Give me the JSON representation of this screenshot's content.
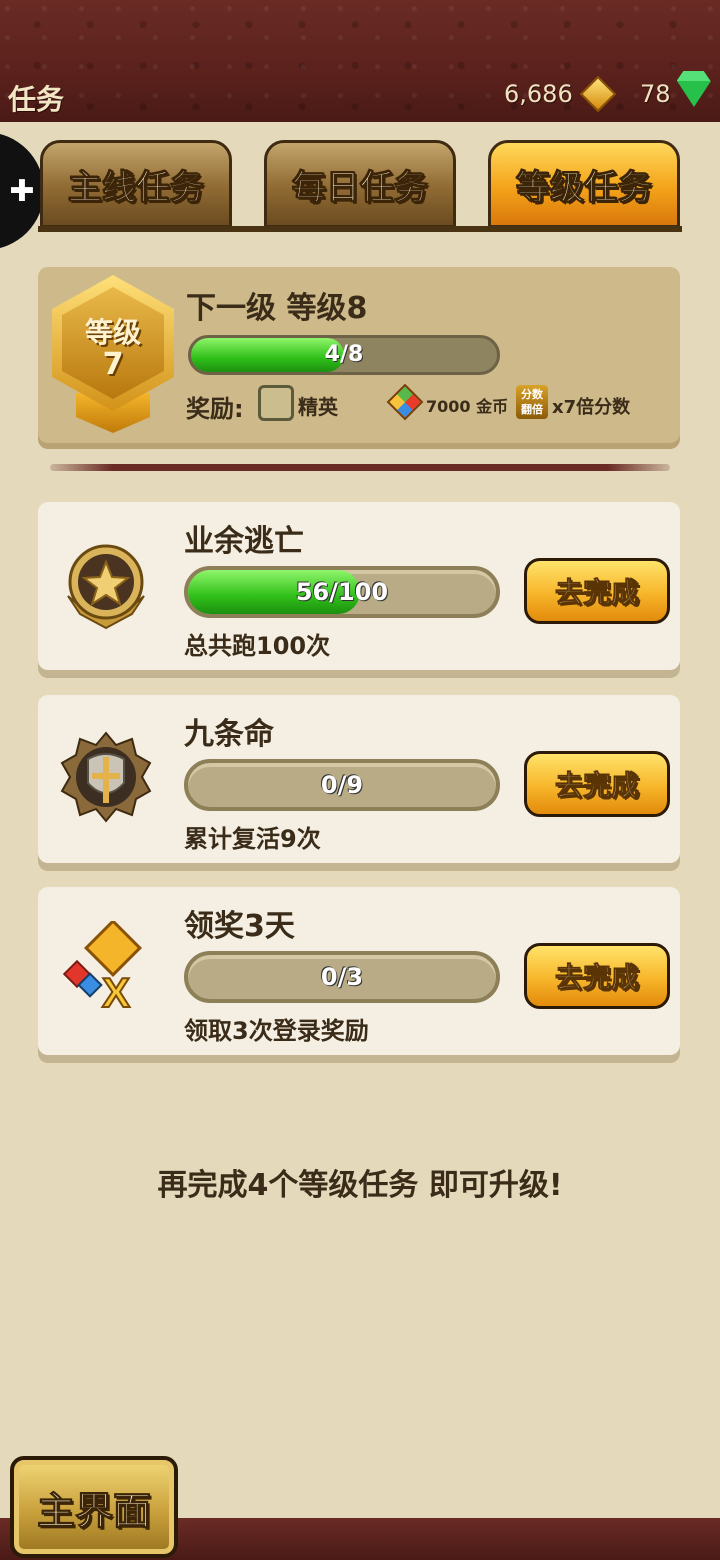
{
  "header": {
    "title": "任务",
    "coins": "6,686",
    "gems": "78"
  },
  "tabs": [
    {
      "label": "主线任务",
      "active": false
    },
    {
      "label": "每日任务",
      "active": false
    },
    {
      "label": "等级任务",
      "active": true
    }
  ],
  "level": {
    "badge_label": "等级",
    "badge_level": "7",
    "next_label": "下一级 等级8",
    "progress_text": "4/8",
    "progress_value": 0.5,
    "reward_label": "奖励:",
    "reward_frame": "精英",
    "reward_coins": "7000 金币",
    "score_icon_text": "分数翻倍",
    "reward_score": "x7倍分数"
  },
  "tasks": [
    {
      "name": "业余逃亡",
      "progress_text": "56/100",
      "progress_value": 0.56,
      "desc": "总共跑100次",
      "button": "去完成",
      "icon": "star-medal-icon"
    },
    {
      "name": "九条命",
      "progress_text": "0/9",
      "progress_value": 0,
      "desc": "累计复活9次",
      "button": "去完成",
      "icon": "shield-cross-icon"
    },
    {
      "name": "领奖3天",
      "progress_text": "0/3",
      "progress_value": 0,
      "desc": "领取3次登录奖励",
      "button": "去完成",
      "icon": "bonus-x-icon"
    }
  ],
  "hint": "再完成4个等级任务 即可升级!",
  "home_button": "主界面",
  "colors": {
    "accent": "#f4a31a",
    "progress_green": "#2fbf19",
    "background": "#e4d9bb",
    "leather": "#5b211c"
  }
}
